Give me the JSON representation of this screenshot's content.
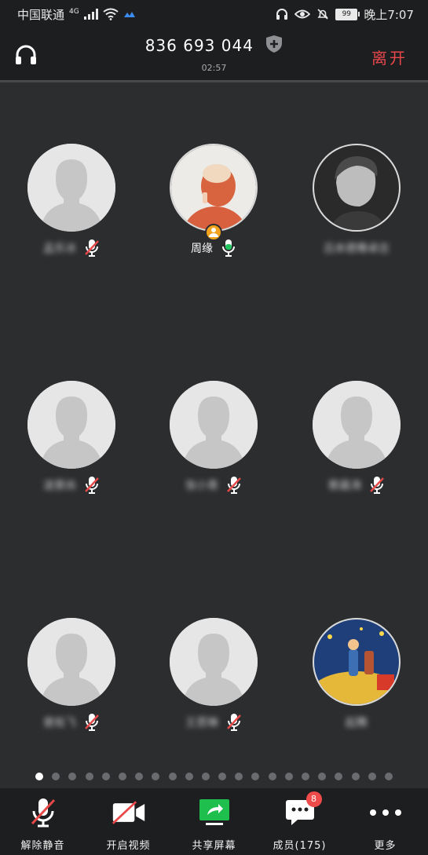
{
  "status_bar": {
    "carrier": "中国联通",
    "network": "4G",
    "battery": "99",
    "time": "晚上7:07"
  },
  "header": {
    "meeting_id": "836 693 044",
    "elapsed": "02:57",
    "leave_label": "离开"
  },
  "participants": [
    {
      "name": "孟乐冰",
      "mic": "muted",
      "avatar": "default"
    },
    {
      "name": "周缘",
      "mic": "active",
      "avatar": "photo-girl",
      "host": true
    },
    {
      "name": "吕本德骞卓志",
      "mic": "none",
      "avatar": "photo-man"
    },
    {
      "name": "凌景尚",
      "mic": "muted",
      "avatar": "default"
    },
    {
      "name": "张小青",
      "mic": "muted",
      "avatar": "default"
    },
    {
      "name": "蔡晨涛",
      "mic": "muted",
      "avatar": "default"
    },
    {
      "name": "曾佑飞",
      "mic": "muted",
      "avatar": "default"
    },
    {
      "name": "王思琳",
      "mic": "muted",
      "avatar": "default"
    },
    {
      "name": "起舞",
      "mic": "none",
      "avatar": "photo-prince"
    }
  ],
  "pagination": {
    "total_pages": 22,
    "current_page": 1
  },
  "toolbar": {
    "unmute": "解除静音",
    "video": "开启视频",
    "share": "共享屏幕",
    "members": "成员(175)",
    "members_badge": "8",
    "more": "更多"
  },
  "colors": {
    "background": "#2c2d2f",
    "bar": "#1d1e20",
    "leave": "#e8474c",
    "mic_active": "#22c55e",
    "mute_slash": "#e84848",
    "share": "#1fbf4d",
    "badge": "#f04b4b",
    "host_badge": "#f4a11d"
  }
}
